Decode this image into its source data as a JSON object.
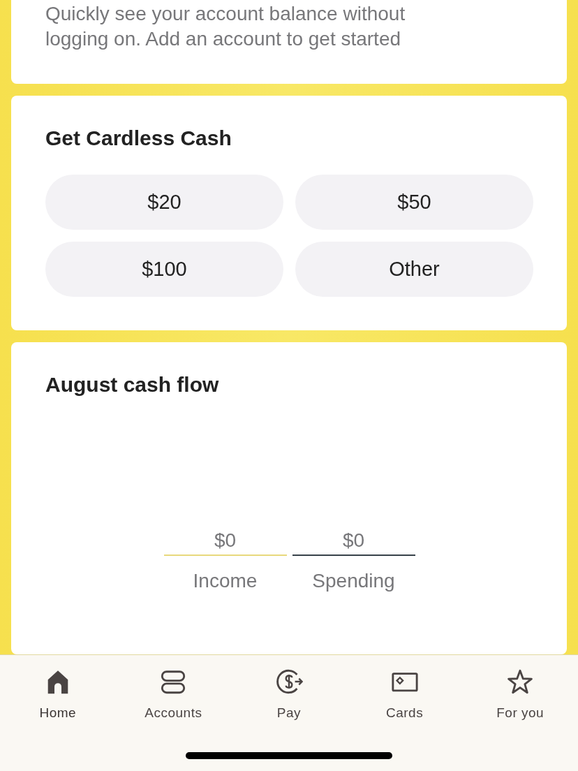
{
  "balance_card": {
    "text": "Quickly see your account balance without logging on. Add an account to get started"
  },
  "cardless_cash": {
    "title": "Get Cardless Cash",
    "options": [
      "$20",
      "$50",
      "$100",
      "Other"
    ]
  },
  "cash_flow": {
    "title": "August cash flow",
    "totals": [
      {
        "amount": "$0",
        "label": "Income",
        "color": "#e8d87c"
      },
      {
        "amount": "$0",
        "label": "Spending",
        "color": "#37424a"
      }
    ]
  },
  "tab_bar": [
    {
      "label": "Home",
      "kind": "home",
      "selected": true
    },
    {
      "label": "Accounts",
      "kind": "accounts",
      "selected": false
    },
    {
      "label": "Pay",
      "kind": "pay",
      "selected": false
    },
    {
      "label": "Cards",
      "kind": "cards",
      "selected": false
    },
    {
      "label": "For you",
      "kind": "star",
      "selected": false
    }
  ]
}
